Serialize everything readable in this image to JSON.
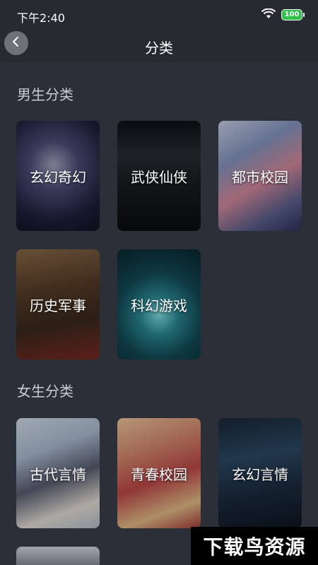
{
  "status_bar": {
    "time": "下午2:40",
    "battery": "100"
  },
  "nav": {
    "title": "分类"
  },
  "sections": [
    {
      "title": "男生分类",
      "items": [
        {
          "label": "玄幻奇幻"
        },
        {
          "label": "武侠仙侠"
        },
        {
          "label": "都市校园"
        },
        {
          "label": "历史军事"
        },
        {
          "label": "科幻游戏"
        }
      ]
    },
    {
      "title": "女生分类",
      "items": [
        {
          "label": "古代言情"
        },
        {
          "label": "青春校园"
        },
        {
          "label": "玄幻言情"
        }
      ]
    }
  ],
  "watermark": "下载鸟资源",
  "colors": {
    "background": "#2b2f37",
    "header": "#272a31",
    "battery": "#2ec24a"
  }
}
